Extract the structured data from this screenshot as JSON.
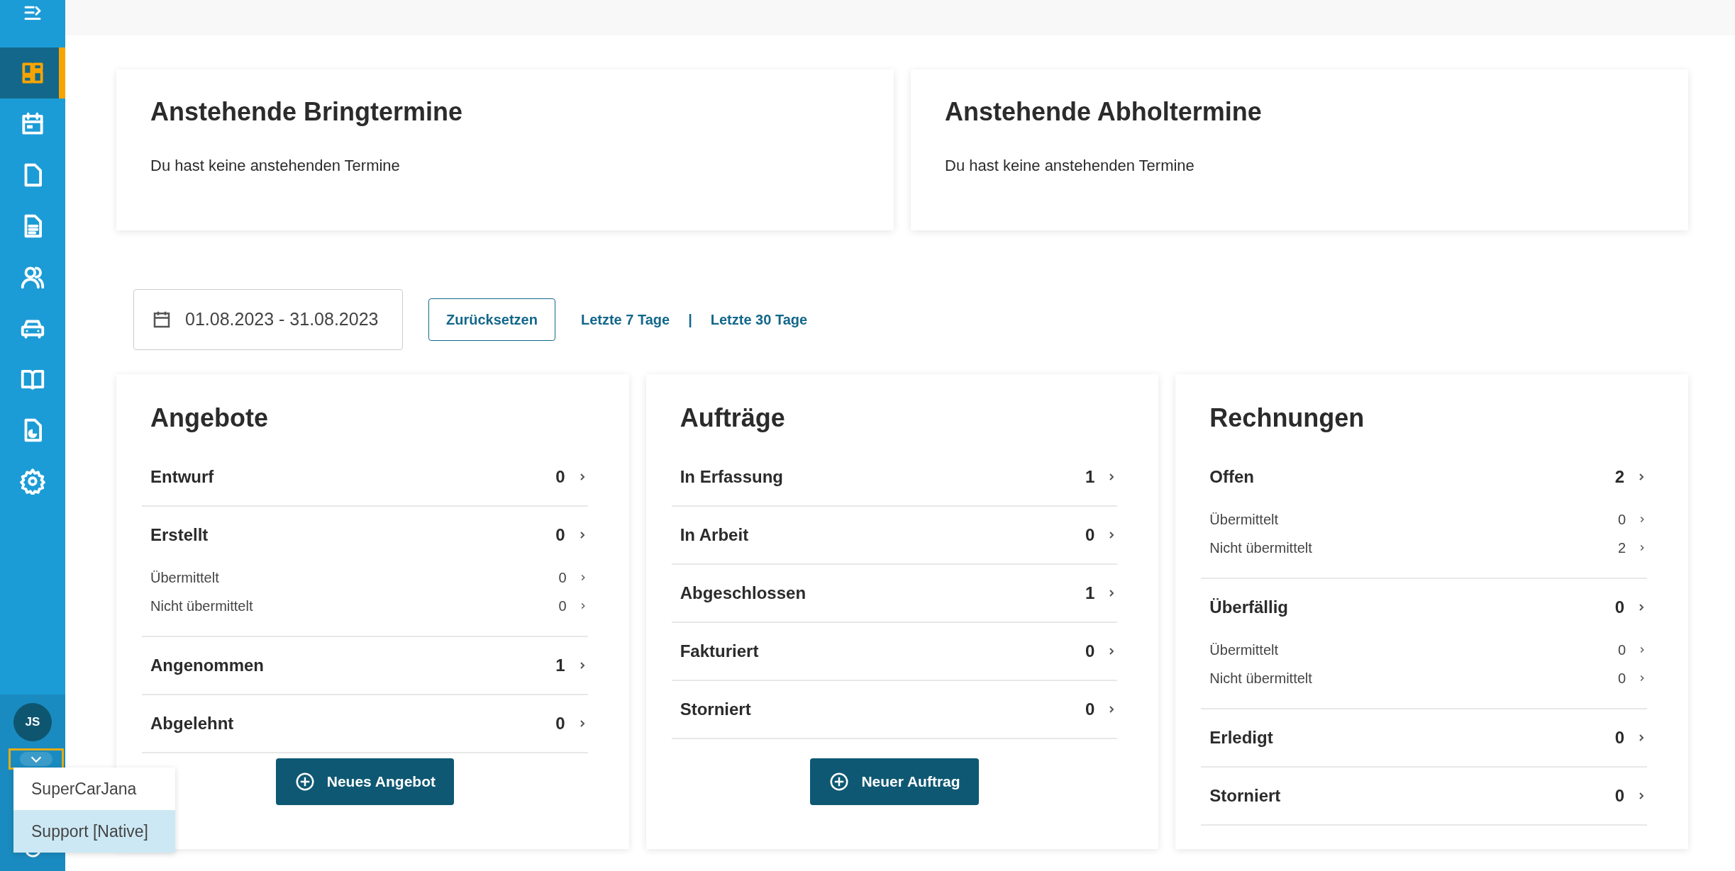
{
  "sidebar": {
    "nav_items": [
      {
        "selected": true
      },
      {
        "selected": false
      },
      {
        "selected": false
      },
      {
        "selected": false
      },
      {
        "selected": false
      },
      {
        "selected": false
      },
      {
        "selected": false
      },
      {
        "selected": false
      },
      {
        "selected": false
      }
    ],
    "user": {
      "initials": "JS"
    },
    "account_menu": {
      "expanded": true,
      "items": [
        {
          "label": "SuperCarJana",
          "selected": false
        },
        {
          "label": "Support [Native]",
          "selected": true
        }
      ]
    }
  },
  "appointments": [
    {
      "title": "Anstehende Bringtermine",
      "message": "Du hast keine anstehenden Termine"
    },
    {
      "title": "Anstehende Abholtermine",
      "message": "Du hast keine anstehenden Termine"
    }
  ],
  "date_filter": {
    "range": "01.08.2023 - 31.08.2023",
    "reset": "Zurücksetzen",
    "quick_links": [
      "Letzte 7 Tage",
      "Letzte 30 Tage"
    ],
    "separator": "|"
  },
  "stats": [
    {
      "title": "Angebote",
      "rows": [
        {
          "label": "Entwurf",
          "count": "0"
        },
        {
          "label": "Erstellt",
          "count": "0",
          "children": [
            {
              "label": "Übermittelt",
              "count": "0"
            },
            {
              "label": "Nicht übermittelt",
              "count": "0"
            }
          ]
        },
        {
          "label": "Angenommen",
          "count": "1"
        },
        {
          "label": "Abgelehnt",
          "count": "0"
        }
      ],
      "button": "Neues Angebot"
    },
    {
      "title": "Aufträge",
      "rows": [
        {
          "label": "In Erfassung",
          "count": "1"
        },
        {
          "label": "In Arbeit",
          "count": "0"
        },
        {
          "label": "Abgeschlossen",
          "count": "1"
        },
        {
          "label": "Fakturiert",
          "count": "0"
        },
        {
          "label": "Storniert",
          "count": "0"
        }
      ],
      "button": "Neuer Auftrag"
    },
    {
      "title": "Rechnungen",
      "rows": [
        {
          "label": "Offen",
          "count": "2",
          "children": [
            {
              "label": "Übermittelt",
              "count": "0"
            },
            {
              "label": "Nicht übermittelt",
              "count": "2"
            }
          ]
        },
        {
          "label": "Überfällig",
          "count": "0",
          "children": [
            {
              "label": "Übermittelt",
              "count": "0"
            },
            {
              "label": "Nicht übermittelt",
              "count": "0"
            }
          ]
        },
        {
          "label": "Erledigt",
          "count": "0"
        },
        {
          "label": "Storniert",
          "count": "0"
        }
      ]
    }
  ]
}
